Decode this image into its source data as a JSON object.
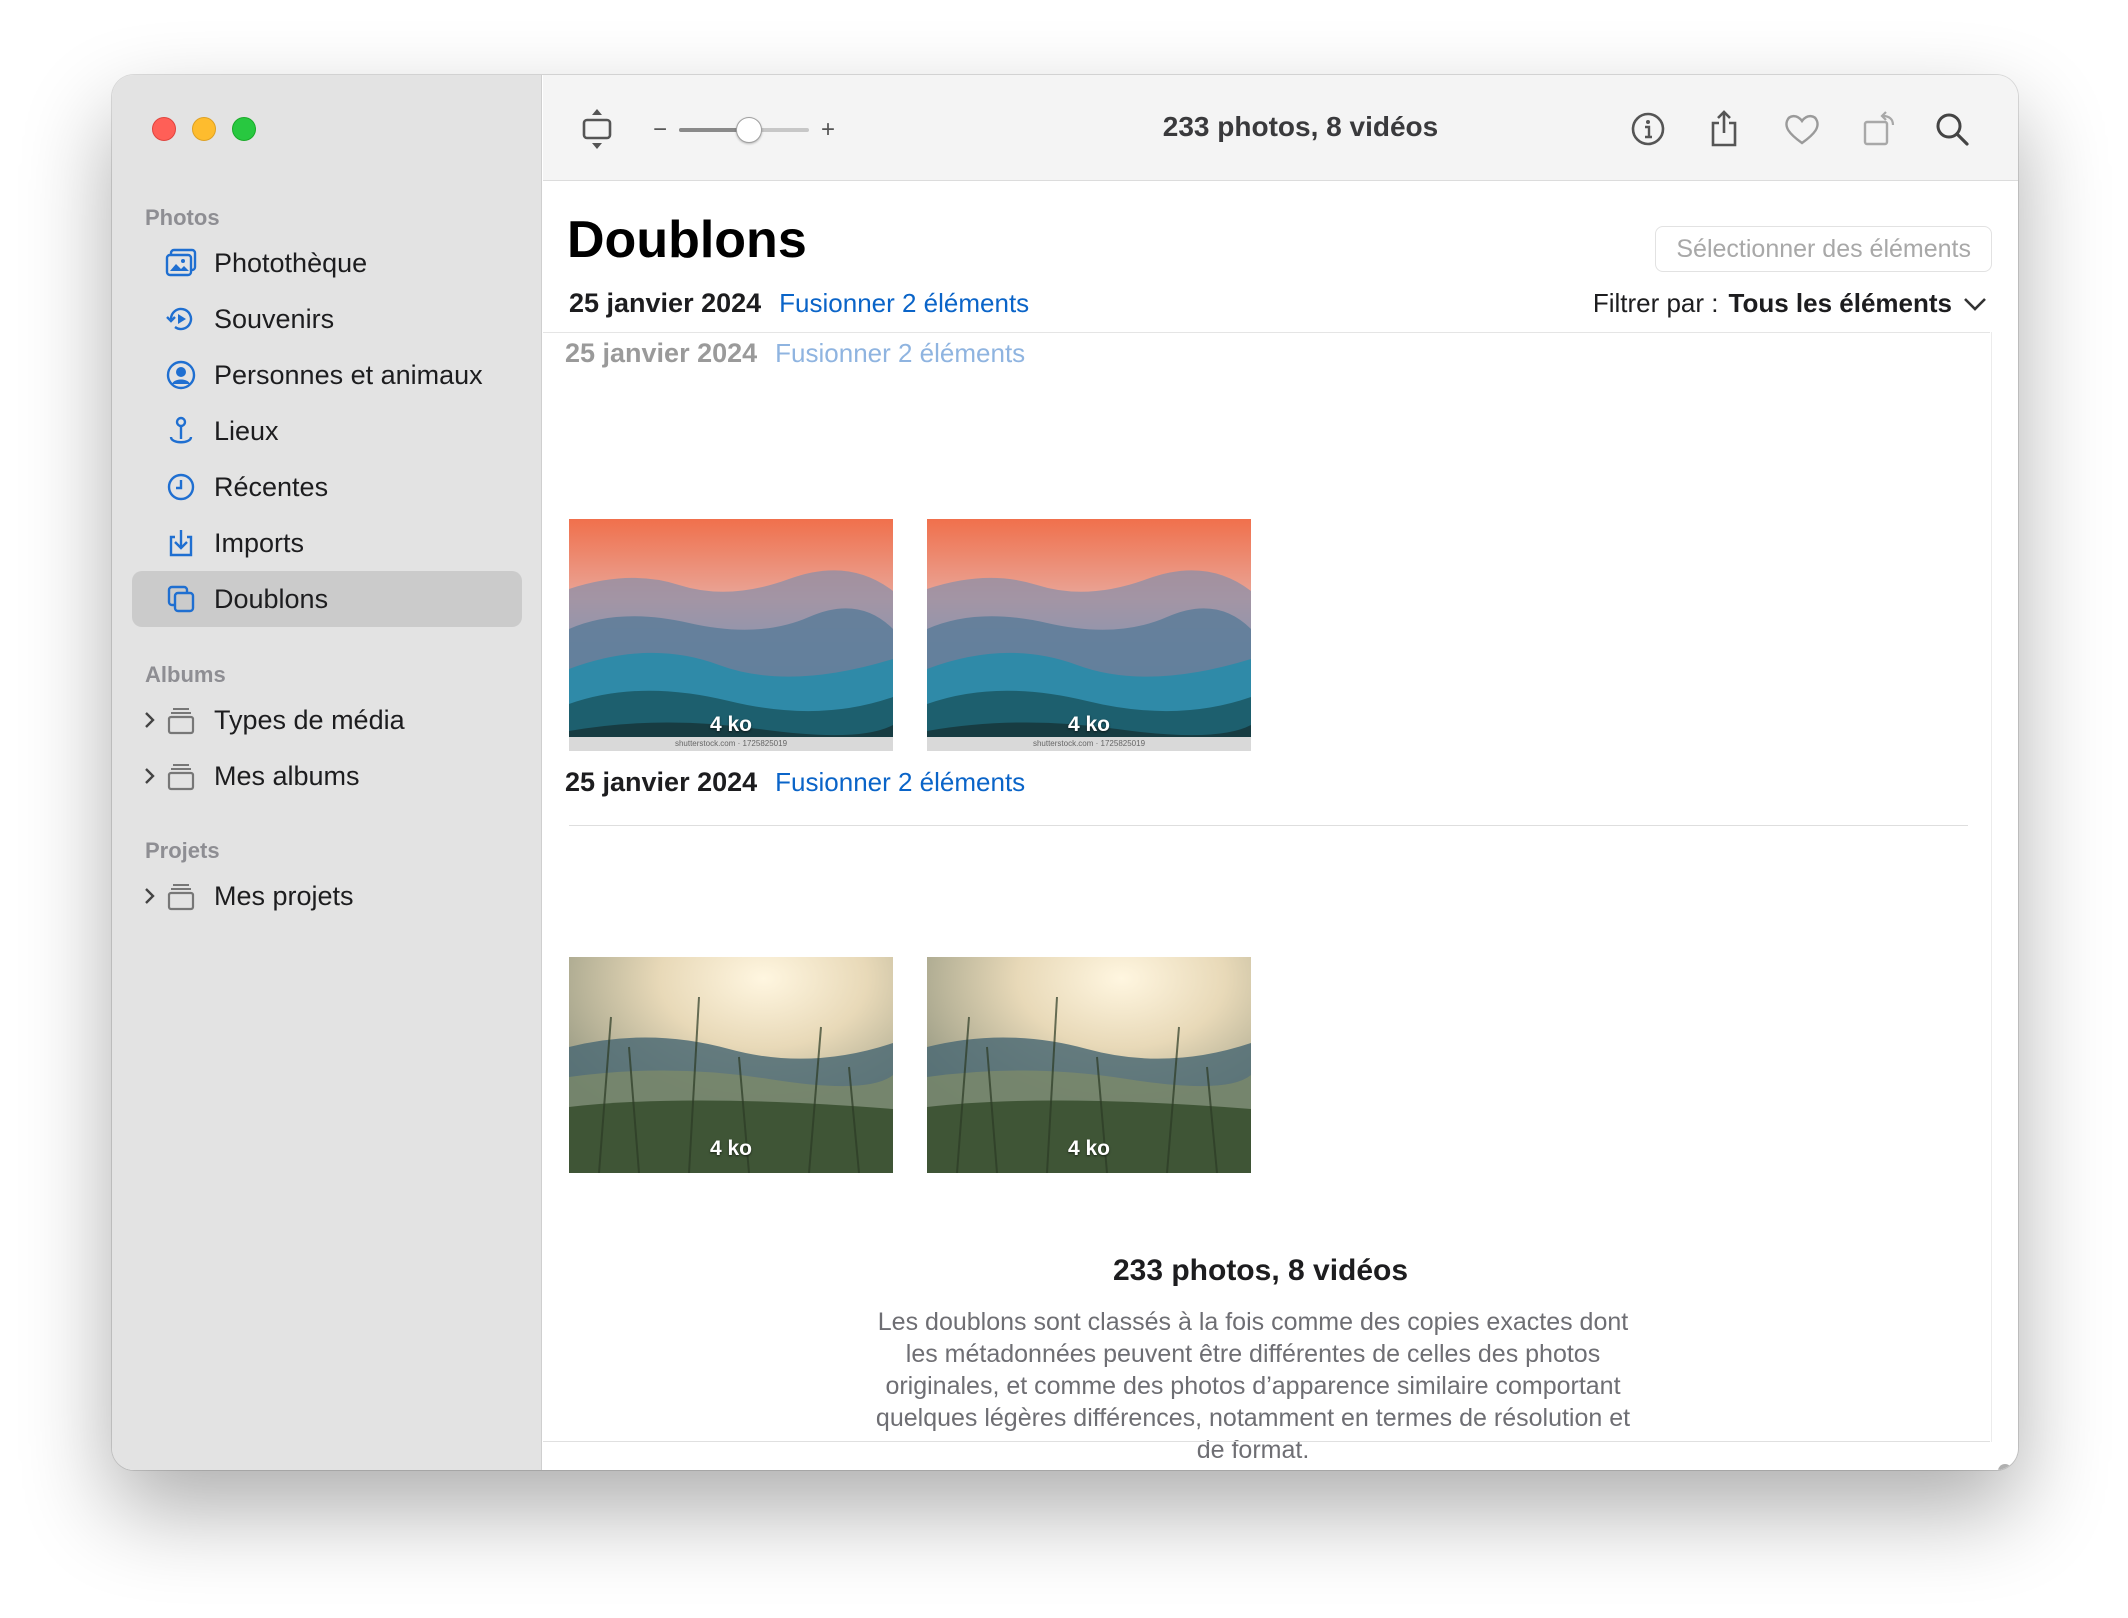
{
  "toolbar": {
    "title": "233 photos, 8 vidéos",
    "slider_minus": "−",
    "slider_plus": "+",
    "zoom_level": 0.55
  },
  "sidebar": {
    "sections": {
      "photos": "Photos",
      "albums": "Albums",
      "projects": "Projets"
    },
    "items": [
      {
        "label": "Photothèque",
        "icon": "photo-library-icon"
      },
      {
        "label": "Souvenirs",
        "icon": "memories-icon"
      },
      {
        "label": "Personnes et animaux",
        "icon": "people-icon"
      },
      {
        "label": "Lieux",
        "icon": "places-icon"
      },
      {
        "label": "Récentes",
        "icon": "clock-icon"
      },
      {
        "label": "Imports",
        "icon": "import-icon"
      },
      {
        "label": "Doublons",
        "icon": "duplicates-icon",
        "selected": true
      }
    ],
    "album_items": [
      {
        "label": "Types de média",
        "icon": "album-stack-icon"
      },
      {
        "label": "Mes albums",
        "icon": "album-stack-icon"
      }
    ],
    "project_items": [
      {
        "label": "Mes projets",
        "icon": "album-stack-icon"
      }
    ]
  },
  "main": {
    "title": "Doublons",
    "select_button": "Sélectionner des éléments",
    "filter_label": "Filtrer par :",
    "filter_value": "Tous les éléments",
    "sticky_header": {
      "date": "25 janvier 2024",
      "merge": "Fusionner 2 éléments"
    },
    "groups": [
      {
        "date": "25 janvier 2024",
        "merge": "Fusionner 2 éléments",
        "items": [
          {
            "size": "4 ko",
            "credit": "shutterstock.com · 1725825019"
          },
          {
            "size": "4 ko",
            "credit": "shutterstock.com · 1725825019"
          }
        ]
      },
      {
        "date": "25 janvier 2024",
        "merge": "Fusionner 2 éléments",
        "items": [
          {
            "size": "4 ko"
          },
          {
            "size": "4 ko"
          }
        ]
      }
    ],
    "summary_title": "233 photos, 8 vidéos",
    "summary_text": "Les doublons sont classés à la fois comme des copies exactes dont les métadonnées peuvent être différentes de celles des photos originales, et comme des photos d’apparence similaire comportant quelques légères différences, notamment en termes de résolution et de format."
  },
  "colors": {
    "accent": "#0a64c8",
    "sidebar_bg": "#e3e3e3",
    "selected_bg": "#cbcbcb",
    "icon_blue": "#1f6fd1"
  }
}
